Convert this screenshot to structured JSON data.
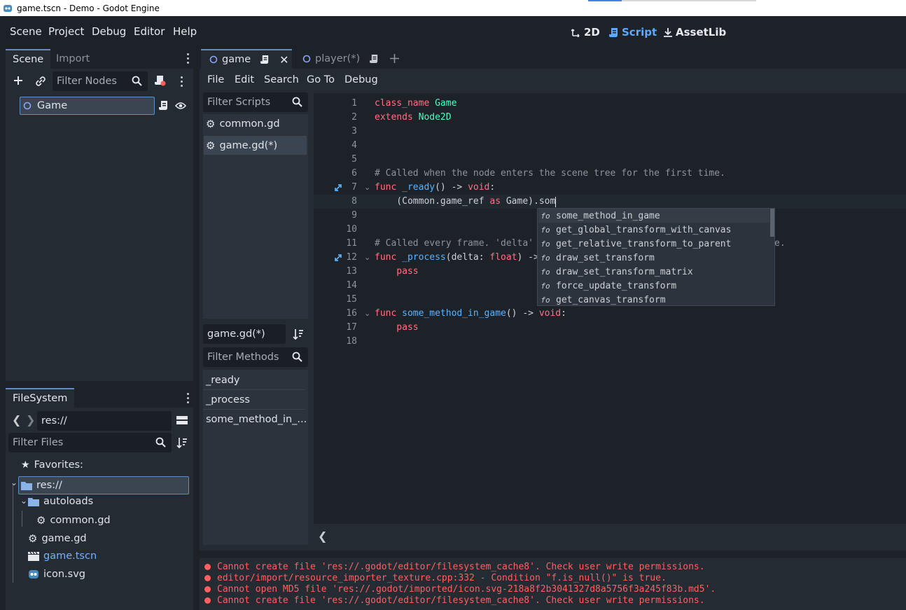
{
  "window": {
    "title": "game.tscn - Demo - Godot Engine"
  },
  "menu": {
    "items": [
      "Scene",
      "Project",
      "Debug",
      "Editor",
      "Help"
    ]
  },
  "workspaces": {
    "items": [
      "2D",
      "Script",
      "AssetLib"
    ],
    "active": "Script"
  },
  "scene_dock": {
    "tabs": [
      "Scene",
      "Import"
    ],
    "filter_placeholder": "Filter Nodes",
    "root_node": "Game"
  },
  "filesystem_dock": {
    "tab": "FileSystem",
    "path": "res://",
    "filter_placeholder": "Filter Files",
    "favorites_label": "Favorites:",
    "tree": [
      {
        "label": "res://",
        "type": "folder"
      },
      {
        "label": "autoloads",
        "type": "folder"
      },
      {
        "label": "common.gd",
        "type": "script"
      },
      {
        "label": "game.gd",
        "type": "script"
      },
      {
        "label": "game.tscn",
        "type": "scene"
      },
      {
        "label": "icon.svg",
        "type": "image"
      }
    ]
  },
  "editor_tabs": {
    "tabs": [
      "game",
      "player(*)"
    ]
  },
  "script_menu": {
    "items": [
      "File",
      "Edit",
      "Search",
      "Go To",
      "Debug"
    ]
  },
  "scripts_panel": {
    "filter_placeholder": "Filter Scripts",
    "scripts": [
      "common.gd",
      "game.gd(*)"
    ],
    "current": "game.gd(*)",
    "methods_filter_placeholder": "Filter Methods",
    "methods": [
      "_ready",
      "_process",
      "some_method_in_..."
    ]
  },
  "code": {
    "line_numbers": [
      "1",
      "2",
      "3",
      "4",
      "5",
      "6",
      "7",
      "8",
      "9",
      "10",
      "11",
      "12",
      "13",
      "14",
      "15",
      "16",
      "17",
      "18"
    ],
    "line1": {
      "kw": "class_name",
      "name": "Game"
    },
    "line2": {
      "kw": "extends",
      "name": "Node2D"
    },
    "line6": "# Called when the node enters the scene tree for the first time.",
    "line7": {
      "kw": "func",
      "name": "_ready",
      "rest": "() -> ",
      "ret": "void",
      "end": ":"
    },
    "line8": {
      "pre": "    (Common.game_ref ",
      "kw": "as",
      "post": " Game).som"
    },
    "line11": "# Called every frame. 'delta'",
    "line11_tail": "e.",
    "line12": {
      "kw": "func",
      "name": "_process",
      "pre": "(delta: ",
      "type": "float",
      "post": ") ->"
    },
    "line13": "    pass",
    "line16": {
      "kw": "func",
      "name": "some_method_in_game",
      "rest": "() -> ",
      "ret": "void",
      "end": ":"
    },
    "line17": "    pass"
  },
  "autocomplete": {
    "icon": "fo",
    "items": [
      "some_method_in_game",
      "get_global_transform_with_canvas",
      "get_relative_transform_to_parent",
      "draw_set_transform",
      "draw_set_transform_matrix",
      "force_update_transform",
      "get_canvas_transform"
    ]
  },
  "output": {
    "errors": [
      "Cannot create file 'res://.godot/editor/filesystem_cache8'. Check user write permissions.",
      "editor/import/resource_importer_texture.cpp:332 - Condition \"f.is_null()\" is true.",
      "Cannot open MD5 file 'res://.godot/imported/icon.svg-218a8f2b3041327d8a5756f3a245f83b.md5'.",
      "Cannot create file 'res://.godot/editor/filesystem_cache8'. Check user write permissions."
    ]
  },
  "colors": {
    "background": "#1d2229",
    "panel": "#252b33",
    "accent": "#5e8dc4",
    "keyword": "#ff7085",
    "class": "#42ffc2",
    "function": "#57b3ff",
    "comment": "#8c939c",
    "error": "#ff5f5f"
  }
}
